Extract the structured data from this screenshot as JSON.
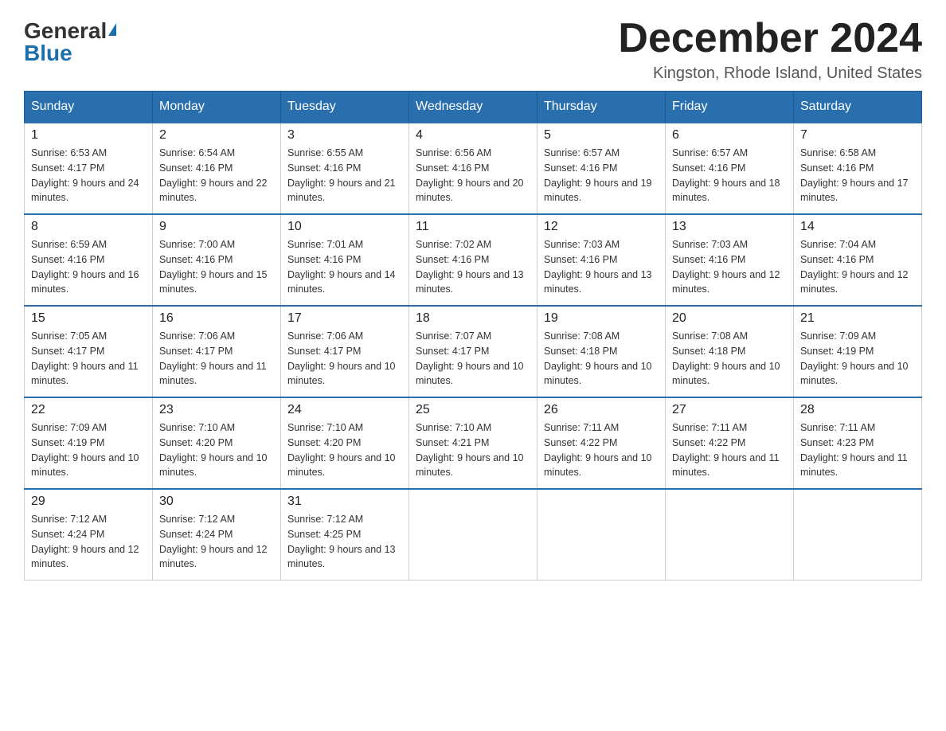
{
  "header": {
    "logo_general": "General",
    "logo_blue": "Blue",
    "title": "December 2024",
    "subtitle": "Kingston, Rhode Island, United States"
  },
  "weekdays": [
    "Sunday",
    "Monday",
    "Tuesday",
    "Wednesday",
    "Thursday",
    "Friday",
    "Saturday"
  ],
  "weeks": [
    [
      {
        "day": "1",
        "sunrise": "6:53 AM",
        "sunset": "4:17 PM",
        "daylight": "9 hours and 24 minutes."
      },
      {
        "day": "2",
        "sunrise": "6:54 AM",
        "sunset": "4:16 PM",
        "daylight": "9 hours and 22 minutes."
      },
      {
        "day": "3",
        "sunrise": "6:55 AM",
        "sunset": "4:16 PM",
        "daylight": "9 hours and 21 minutes."
      },
      {
        "day": "4",
        "sunrise": "6:56 AM",
        "sunset": "4:16 PM",
        "daylight": "9 hours and 20 minutes."
      },
      {
        "day": "5",
        "sunrise": "6:57 AM",
        "sunset": "4:16 PM",
        "daylight": "9 hours and 19 minutes."
      },
      {
        "day": "6",
        "sunrise": "6:57 AM",
        "sunset": "4:16 PM",
        "daylight": "9 hours and 18 minutes."
      },
      {
        "day": "7",
        "sunrise": "6:58 AM",
        "sunset": "4:16 PM",
        "daylight": "9 hours and 17 minutes."
      }
    ],
    [
      {
        "day": "8",
        "sunrise": "6:59 AM",
        "sunset": "4:16 PM",
        "daylight": "9 hours and 16 minutes."
      },
      {
        "day": "9",
        "sunrise": "7:00 AM",
        "sunset": "4:16 PM",
        "daylight": "9 hours and 15 minutes."
      },
      {
        "day": "10",
        "sunrise": "7:01 AM",
        "sunset": "4:16 PM",
        "daylight": "9 hours and 14 minutes."
      },
      {
        "day": "11",
        "sunrise": "7:02 AM",
        "sunset": "4:16 PM",
        "daylight": "9 hours and 13 minutes."
      },
      {
        "day": "12",
        "sunrise": "7:03 AM",
        "sunset": "4:16 PM",
        "daylight": "9 hours and 13 minutes."
      },
      {
        "day": "13",
        "sunrise": "7:03 AM",
        "sunset": "4:16 PM",
        "daylight": "9 hours and 12 minutes."
      },
      {
        "day": "14",
        "sunrise": "7:04 AM",
        "sunset": "4:16 PM",
        "daylight": "9 hours and 12 minutes."
      }
    ],
    [
      {
        "day": "15",
        "sunrise": "7:05 AM",
        "sunset": "4:17 PM",
        "daylight": "9 hours and 11 minutes."
      },
      {
        "day": "16",
        "sunrise": "7:06 AM",
        "sunset": "4:17 PM",
        "daylight": "9 hours and 11 minutes."
      },
      {
        "day": "17",
        "sunrise": "7:06 AM",
        "sunset": "4:17 PM",
        "daylight": "9 hours and 10 minutes."
      },
      {
        "day": "18",
        "sunrise": "7:07 AM",
        "sunset": "4:17 PM",
        "daylight": "9 hours and 10 minutes."
      },
      {
        "day": "19",
        "sunrise": "7:08 AM",
        "sunset": "4:18 PM",
        "daylight": "9 hours and 10 minutes."
      },
      {
        "day": "20",
        "sunrise": "7:08 AM",
        "sunset": "4:18 PM",
        "daylight": "9 hours and 10 minutes."
      },
      {
        "day": "21",
        "sunrise": "7:09 AM",
        "sunset": "4:19 PM",
        "daylight": "9 hours and 10 minutes."
      }
    ],
    [
      {
        "day": "22",
        "sunrise": "7:09 AM",
        "sunset": "4:19 PM",
        "daylight": "9 hours and 10 minutes."
      },
      {
        "day": "23",
        "sunrise": "7:10 AM",
        "sunset": "4:20 PM",
        "daylight": "9 hours and 10 minutes."
      },
      {
        "day": "24",
        "sunrise": "7:10 AM",
        "sunset": "4:20 PM",
        "daylight": "9 hours and 10 minutes."
      },
      {
        "day": "25",
        "sunrise": "7:10 AM",
        "sunset": "4:21 PM",
        "daylight": "9 hours and 10 minutes."
      },
      {
        "day": "26",
        "sunrise": "7:11 AM",
        "sunset": "4:22 PM",
        "daylight": "9 hours and 10 minutes."
      },
      {
        "day": "27",
        "sunrise": "7:11 AM",
        "sunset": "4:22 PM",
        "daylight": "9 hours and 11 minutes."
      },
      {
        "day": "28",
        "sunrise": "7:11 AM",
        "sunset": "4:23 PM",
        "daylight": "9 hours and 11 minutes."
      }
    ],
    [
      {
        "day": "29",
        "sunrise": "7:12 AM",
        "sunset": "4:24 PM",
        "daylight": "9 hours and 12 minutes."
      },
      {
        "day": "30",
        "sunrise": "7:12 AM",
        "sunset": "4:24 PM",
        "daylight": "9 hours and 12 minutes."
      },
      {
        "day": "31",
        "sunrise": "7:12 AM",
        "sunset": "4:25 PM",
        "daylight": "9 hours and 13 minutes."
      },
      null,
      null,
      null,
      null
    ]
  ],
  "labels": {
    "sunrise_prefix": "Sunrise: ",
    "sunset_prefix": "Sunset: ",
    "daylight_prefix": "Daylight: "
  }
}
